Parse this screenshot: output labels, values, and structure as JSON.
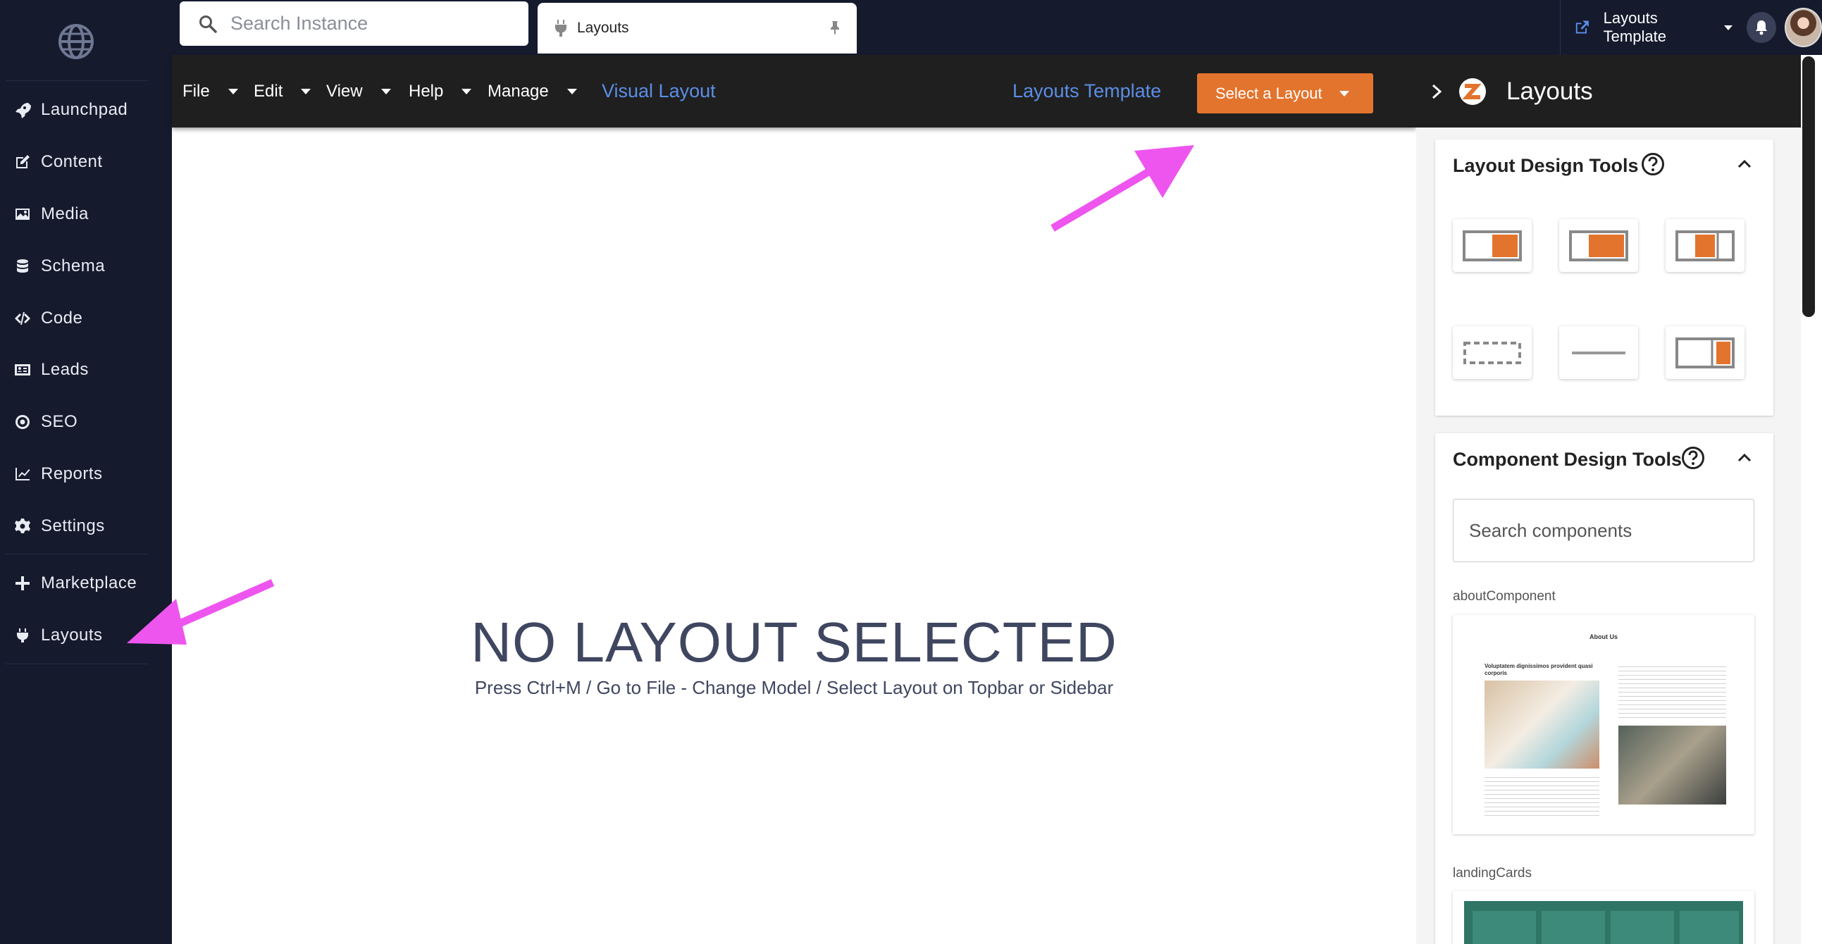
{
  "sidebar": {
    "items": [
      {
        "label": "Launchpad",
        "icon": "rocket-icon"
      },
      {
        "label": "Content",
        "icon": "edit-icon"
      },
      {
        "label": "Media",
        "icon": "image-icon"
      },
      {
        "label": "Schema",
        "icon": "database-icon"
      },
      {
        "label": "Code",
        "icon": "code-icon"
      },
      {
        "label": "Leads",
        "icon": "contact-card-icon"
      },
      {
        "label": "SEO",
        "icon": "target-icon"
      },
      {
        "label": "Reports",
        "icon": "chart-line-icon"
      },
      {
        "label": "Settings",
        "icon": "gear-icon"
      },
      {
        "label": "Marketplace",
        "icon": "plus-icon"
      },
      {
        "label": "Layouts",
        "icon": "plug-icon"
      }
    ]
  },
  "topbar": {
    "search_placeholder": "Search Instance",
    "open_tab": "Layouts",
    "instance_name": "Layouts Template"
  },
  "menubar": {
    "file": "File",
    "edit": "Edit",
    "view": "View",
    "help": "Help",
    "manage": "Manage",
    "mode_link": "Visual Layout",
    "template_link": "Layouts Template",
    "select_layout": "Select a Layout"
  },
  "canvas": {
    "empty_title": "NO LAYOUT SELECTED",
    "empty_hint": "Press Ctrl+M / Go to File - Change Model / Select Layout on Topbar or Sidebar"
  },
  "panel": {
    "title": "Layouts",
    "layout_tools_title": "Layout Design Tools",
    "component_tools_title": "Component Design Tools",
    "component_search_placeholder": "Search components",
    "components": [
      "aboutComponent",
      "landingCards"
    ],
    "about_preview": {
      "heading": "About Us",
      "subheading": "Voluptatem dignissimos provident quasi corporis"
    }
  },
  "colors": {
    "accent": "#e3742d",
    "link": "#5b8ee6",
    "sidebar_bg": "#151a2d",
    "annotation": "#ee55ee"
  }
}
